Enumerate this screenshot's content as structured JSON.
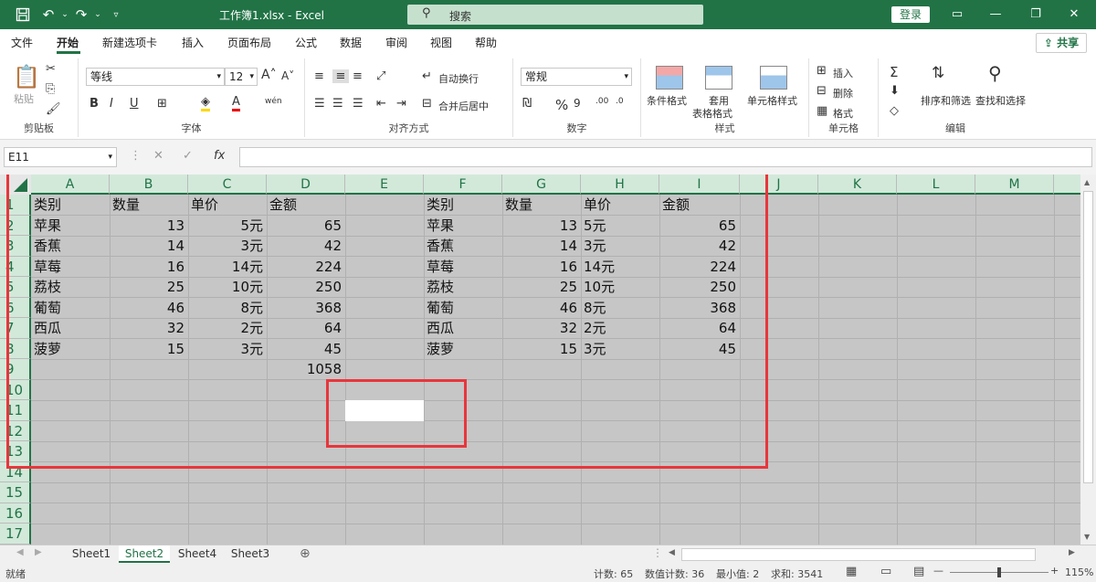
{
  "titlebar": {
    "title": "工作簿1.xlsx  -  Excel",
    "search_placeholder": "搜索",
    "login_label": "登录",
    "qat_icons": [
      "save-icon",
      "undo-icon",
      "redo-icon",
      "customize-icon"
    ]
  },
  "menu": {
    "items": [
      "文件",
      "开始",
      "新建选项卡",
      "插入",
      "页面布局",
      "公式",
      "数据",
      "审阅",
      "视图",
      "帮助"
    ],
    "active": "开始",
    "share_label": "共享"
  },
  "ribbon": {
    "clipboard": {
      "label": "剪贴板",
      "paste_label": "粘贴"
    },
    "font": {
      "label": "字体",
      "font_name": "等线",
      "font_size": "12",
      "bold": "B",
      "italic": "I",
      "underline": "U"
    },
    "align": {
      "label": "对齐方式",
      "wrap_label": "自动换行",
      "merge_label": "合并后居中"
    },
    "number": {
      "label": "数字",
      "format": "常规"
    },
    "styles": {
      "label": "样式",
      "cond_format": "条件格式",
      "table_format_1": "套用",
      "table_format_2": "表格格式",
      "cell_styles": "单元格样式"
    },
    "cells": {
      "label": "单元格",
      "insert": "插入",
      "delete": "删除",
      "format": "格式"
    },
    "editing": {
      "label": "编辑",
      "sort_filter": "排序和筛选",
      "find_select": "查找和选择"
    }
  },
  "formula_bar": {
    "name_box": "E11",
    "value": ""
  },
  "columns": [
    "A",
    "B",
    "C",
    "D",
    "E",
    "F",
    "G",
    "H",
    "I",
    "J",
    "K",
    "L",
    "M"
  ],
  "rows": [
    "1",
    "2",
    "3",
    "4",
    "5",
    "6",
    "7",
    "8",
    "9",
    "10",
    "11",
    "12",
    "13",
    "14",
    "15",
    "16",
    "17"
  ],
  "table_left": {
    "headers": [
      "类别",
      "数量",
      "单价",
      "金额"
    ],
    "rows": [
      [
        "苹果",
        "13",
        "5元",
        "65"
      ],
      [
        "香蕉",
        "14",
        "3元",
        "42"
      ],
      [
        "草莓",
        "16",
        "14元",
        "224"
      ],
      [
        "荔枝",
        "25",
        "10元",
        "250"
      ],
      [
        "葡萄",
        "46",
        "8元",
        "368"
      ],
      [
        "西瓜",
        "32",
        "2元",
        "64"
      ],
      [
        "菠萝",
        "15",
        "3元",
        "45"
      ]
    ],
    "total": "1058"
  },
  "table_right": {
    "headers": [
      "类别",
      "数量",
      "单价",
      "金额"
    ],
    "rows": [
      [
        "苹果",
        "13",
        "5元",
        "65"
      ],
      [
        "香蕉",
        "14",
        "3元",
        "42"
      ],
      [
        "草莓",
        "16",
        "14元",
        "224"
      ],
      [
        "荔枝",
        "25",
        "10元",
        "250"
      ],
      [
        "葡萄",
        "46",
        "8元",
        "368"
      ],
      [
        "西瓜",
        "32",
        "2元",
        "64"
      ],
      [
        "菠萝",
        "15",
        "3元",
        "45"
      ]
    ]
  },
  "sheets": [
    "Sheet1",
    "Sheet2",
    "Sheet4",
    "Sheet3"
  ],
  "active_sheet": "Sheet2",
  "status": {
    "ready": "就绪",
    "count": "计数: 65",
    "numeric_count": "数值计数: 36",
    "min": "最小值: 2",
    "sum": "求和: 3541",
    "zoom": "115%"
  },
  "colors": {
    "accent": "#217346",
    "highlight_box": "#e8363c",
    "selection_fill": "#c6c6c6"
  }
}
